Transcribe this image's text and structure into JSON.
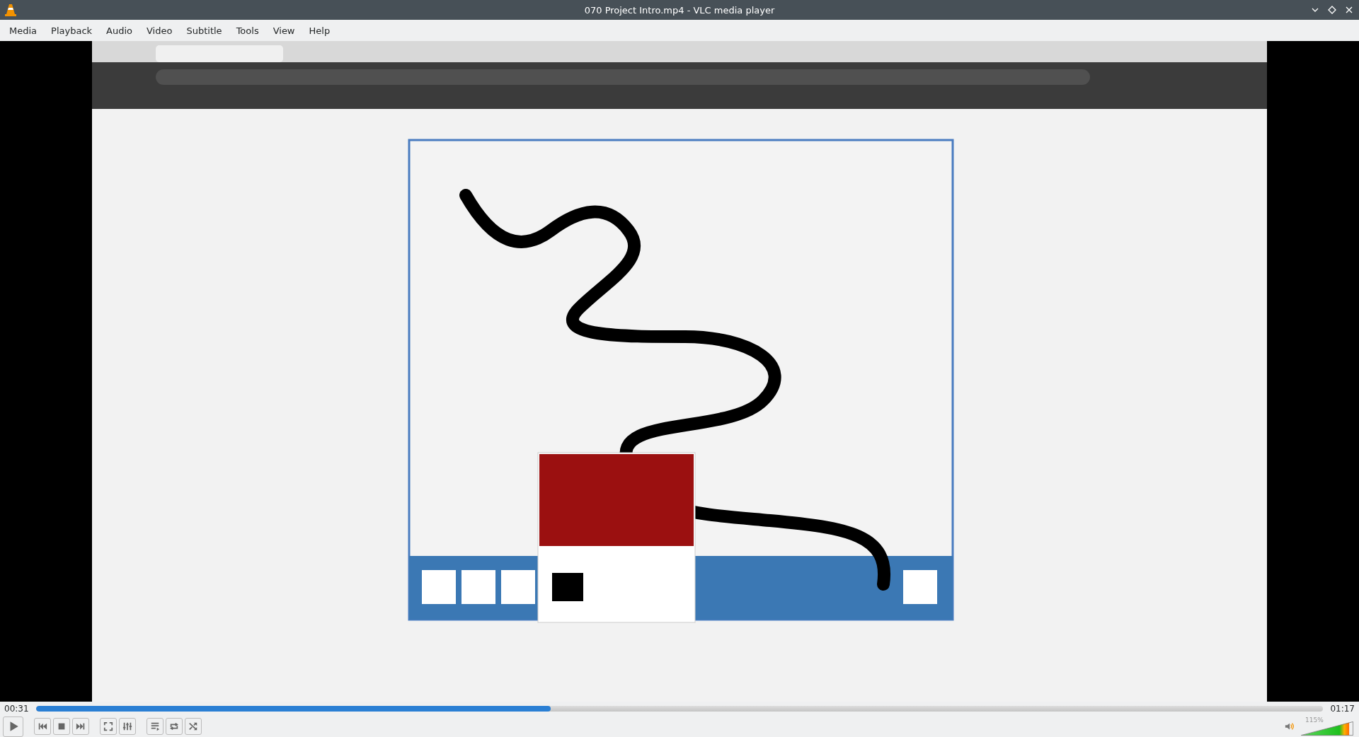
{
  "window": {
    "title": "070 Project Intro.mp4 - VLC media player"
  },
  "menu": [
    {
      "label": "Media"
    },
    {
      "label": "Playback"
    },
    {
      "label": "Audio"
    },
    {
      "label": "Video"
    },
    {
      "label": "Subtitle"
    },
    {
      "label": "Tools"
    },
    {
      "label": "View"
    },
    {
      "label": "Help"
    }
  ],
  "seek": {
    "elapsed": "00:31",
    "total": "01:17",
    "level": 0.4
  },
  "controls": [
    {
      "kind": "play"
    },
    {
      "kind": "gap"
    },
    {
      "kind": "prev"
    },
    {
      "kind": "stop"
    },
    {
      "kind": "next"
    },
    {
      "kind": "gap"
    },
    {
      "kind": "fullscreen"
    },
    {
      "kind": "settings"
    },
    {
      "kind": "gap"
    },
    {
      "kind": "playlist"
    },
    {
      "kind": "loop"
    },
    {
      "kind": "shuffle"
    }
  ],
  "volume": {
    "reading": "115%",
    "level": 0.92
  }
}
